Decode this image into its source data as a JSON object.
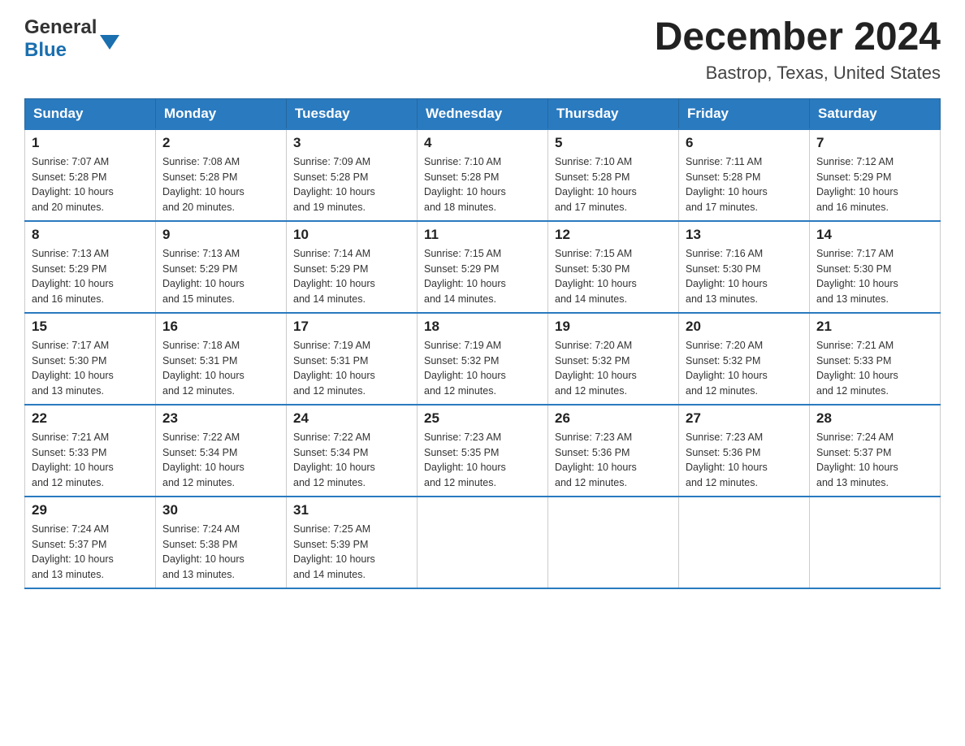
{
  "header": {
    "logo_general": "General",
    "logo_blue": "Blue",
    "month_title": "December 2024",
    "location": "Bastrop, Texas, United States"
  },
  "days_of_week": [
    "Sunday",
    "Monday",
    "Tuesday",
    "Wednesday",
    "Thursday",
    "Friday",
    "Saturday"
  ],
  "weeks": [
    [
      {
        "day": "1",
        "sunrise": "7:07 AM",
        "sunset": "5:28 PM",
        "daylight": "10 hours and 20 minutes."
      },
      {
        "day": "2",
        "sunrise": "7:08 AM",
        "sunset": "5:28 PM",
        "daylight": "10 hours and 20 minutes."
      },
      {
        "day": "3",
        "sunrise": "7:09 AM",
        "sunset": "5:28 PM",
        "daylight": "10 hours and 19 minutes."
      },
      {
        "day": "4",
        "sunrise": "7:10 AM",
        "sunset": "5:28 PM",
        "daylight": "10 hours and 18 minutes."
      },
      {
        "day": "5",
        "sunrise": "7:10 AM",
        "sunset": "5:28 PM",
        "daylight": "10 hours and 17 minutes."
      },
      {
        "day": "6",
        "sunrise": "7:11 AM",
        "sunset": "5:28 PM",
        "daylight": "10 hours and 17 minutes."
      },
      {
        "day": "7",
        "sunrise": "7:12 AM",
        "sunset": "5:29 PM",
        "daylight": "10 hours and 16 minutes."
      }
    ],
    [
      {
        "day": "8",
        "sunrise": "7:13 AM",
        "sunset": "5:29 PM",
        "daylight": "10 hours and 16 minutes."
      },
      {
        "day": "9",
        "sunrise": "7:13 AM",
        "sunset": "5:29 PM",
        "daylight": "10 hours and 15 minutes."
      },
      {
        "day": "10",
        "sunrise": "7:14 AM",
        "sunset": "5:29 PM",
        "daylight": "10 hours and 14 minutes."
      },
      {
        "day": "11",
        "sunrise": "7:15 AM",
        "sunset": "5:29 PM",
        "daylight": "10 hours and 14 minutes."
      },
      {
        "day": "12",
        "sunrise": "7:15 AM",
        "sunset": "5:30 PM",
        "daylight": "10 hours and 14 minutes."
      },
      {
        "day": "13",
        "sunrise": "7:16 AM",
        "sunset": "5:30 PM",
        "daylight": "10 hours and 13 minutes."
      },
      {
        "day": "14",
        "sunrise": "7:17 AM",
        "sunset": "5:30 PM",
        "daylight": "10 hours and 13 minutes."
      }
    ],
    [
      {
        "day": "15",
        "sunrise": "7:17 AM",
        "sunset": "5:30 PM",
        "daylight": "10 hours and 13 minutes."
      },
      {
        "day": "16",
        "sunrise": "7:18 AM",
        "sunset": "5:31 PM",
        "daylight": "10 hours and 12 minutes."
      },
      {
        "day": "17",
        "sunrise": "7:19 AM",
        "sunset": "5:31 PM",
        "daylight": "10 hours and 12 minutes."
      },
      {
        "day": "18",
        "sunrise": "7:19 AM",
        "sunset": "5:32 PM",
        "daylight": "10 hours and 12 minutes."
      },
      {
        "day": "19",
        "sunrise": "7:20 AM",
        "sunset": "5:32 PM",
        "daylight": "10 hours and 12 minutes."
      },
      {
        "day": "20",
        "sunrise": "7:20 AM",
        "sunset": "5:32 PM",
        "daylight": "10 hours and 12 minutes."
      },
      {
        "day": "21",
        "sunrise": "7:21 AM",
        "sunset": "5:33 PM",
        "daylight": "10 hours and 12 minutes."
      }
    ],
    [
      {
        "day": "22",
        "sunrise": "7:21 AM",
        "sunset": "5:33 PM",
        "daylight": "10 hours and 12 minutes."
      },
      {
        "day": "23",
        "sunrise": "7:22 AM",
        "sunset": "5:34 PM",
        "daylight": "10 hours and 12 minutes."
      },
      {
        "day": "24",
        "sunrise": "7:22 AM",
        "sunset": "5:34 PM",
        "daylight": "10 hours and 12 minutes."
      },
      {
        "day": "25",
        "sunrise": "7:23 AM",
        "sunset": "5:35 PM",
        "daylight": "10 hours and 12 minutes."
      },
      {
        "day": "26",
        "sunrise": "7:23 AM",
        "sunset": "5:36 PM",
        "daylight": "10 hours and 12 minutes."
      },
      {
        "day": "27",
        "sunrise": "7:23 AM",
        "sunset": "5:36 PM",
        "daylight": "10 hours and 12 minutes."
      },
      {
        "day": "28",
        "sunrise": "7:24 AM",
        "sunset": "5:37 PM",
        "daylight": "10 hours and 13 minutes."
      }
    ],
    [
      {
        "day": "29",
        "sunrise": "7:24 AM",
        "sunset": "5:37 PM",
        "daylight": "10 hours and 13 minutes."
      },
      {
        "day": "30",
        "sunrise": "7:24 AM",
        "sunset": "5:38 PM",
        "daylight": "10 hours and 13 minutes."
      },
      {
        "day": "31",
        "sunrise": "7:25 AM",
        "sunset": "5:39 PM",
        "daylight": "10 hours and 14 minutes."
      },
      null,
      null,
      null,
      null
    ]
  ],
  "labels": {
    "sunrise": "Sunrise:",
    "sunset": "Sunset:",
    "daylight": "Daylight:"
  }
}
